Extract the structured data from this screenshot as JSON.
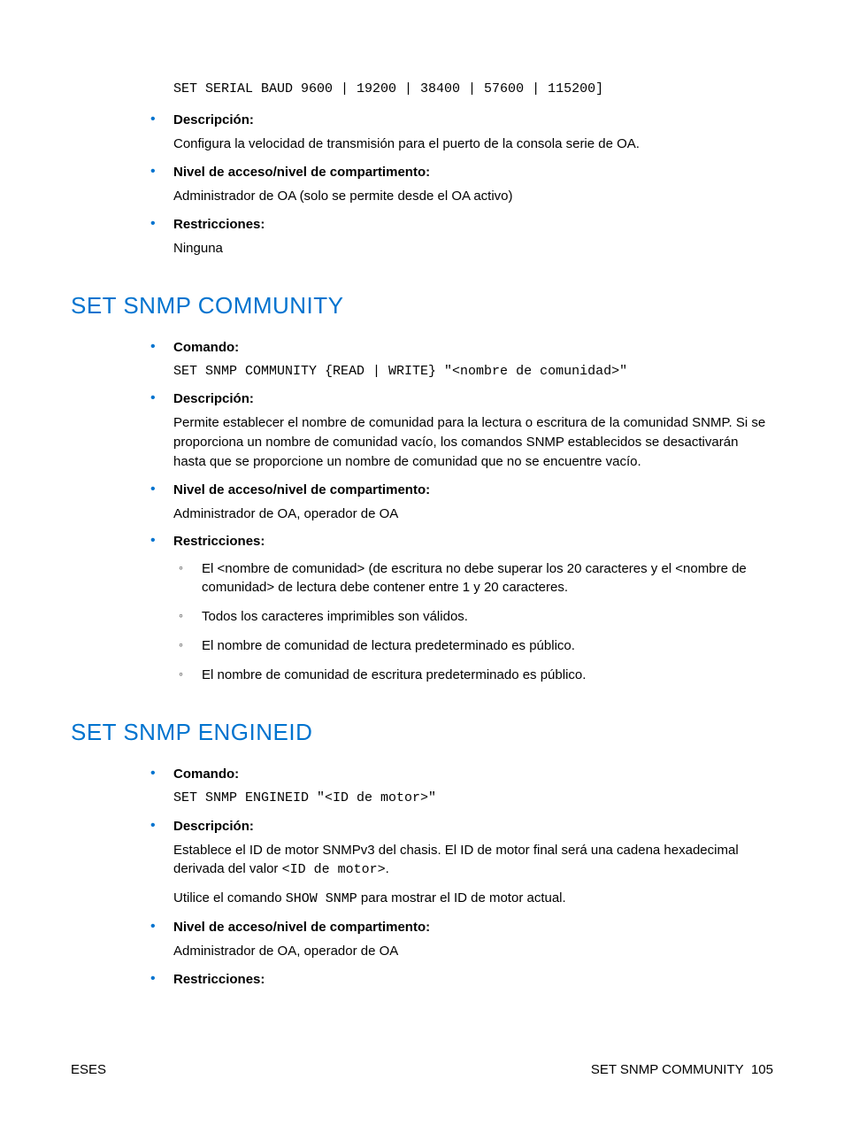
{
  "top_code": "SET SERIAL BAUD 9600 | 19200 | 38400 | 57600 | 115200]",
  "section0": {
    "items": [
      {
        "label": "Descripción:",
        "text": "Configura la velocidad de transmisión para el puerto de la consola serie de OA."
      },
      {
        "label": "Nivel de acceso/nivel de compartimento:",
        "text": "Administrador de OA (solo se permite desde el OA activo)"
      },
      {
        "label": "Restricciones:",
        "text": "Ninguna"
      }
    ]
  },
  "section1": {
    "title": "SET SNMP COMMUNITY",
    "comando_label": "Comando:",
    "comando_code": "SET SNMP COMMUNITY {READ | WRITE} \"<nombre de comunidad>\"",
    "desc_label": "Descripción:",
    "desc_text": "Permite establecer el nombre de comunidad para la lectura o escritura de la comunidad SNMP. Si se proporciona un nombre de comunidad vacío, los comandos SNMP establecidos se desactivarán hasta que se proporcione un nombre de comunidad que no se encuentre vacío.",
    "nivel_label": "Nivel de acceso/nivel de compartimento:",
    "nivel_text": "Administrador de OA, operador de OA",
    "restr_label": "Restricciones:",
    "restr_items": [
      "El <nombre de comunidad> (de escritura no debe superar los 20 caracteres y el <nombre de comunidad> de lectura debe contener entre 1 y 20 caracteres.",
      "Todos los caracteres imprimibles son válidos.",
      "El nombre de comunidad de lectura predeterminado es público.",
      "El nombre de comunidad de escritura predeterminado es público."
    ]
  },
  "section2": {
    "title": "SET SNMP ENGINEID",
    "comando_label": "Comando:",
    "comando_code": "SET SNMP ENGINEID \"<ID de motor>\"",
    "desc_label": "Descripción:",
    "desc_text_pre": "Establece el ID de motor SNMPv3 del chasis. El ID de motor final será una cadena hexadecimal derivada del valor ",
    "desc_text_code": "<ID de motor>",
    "desc_text_post": ".",
    "desc_text2_pre": "Utilice el comando ",
    "desc_text2_code": "SHOW SNMP",
    "desc_text2_post": " para mostrar el ID de motor actual.",
    "nivel_label": "Nivel de acceso/nivel de compartimento:",
    "nivel_text": "Administrador de OA, operador de OA",
    "restr_label": "Restricciones:"
  },
  "footer": {
    "left": "ESES",
    "right_text": "SET SNMP COMMUNITY",
    "page": "105"
  }
}
